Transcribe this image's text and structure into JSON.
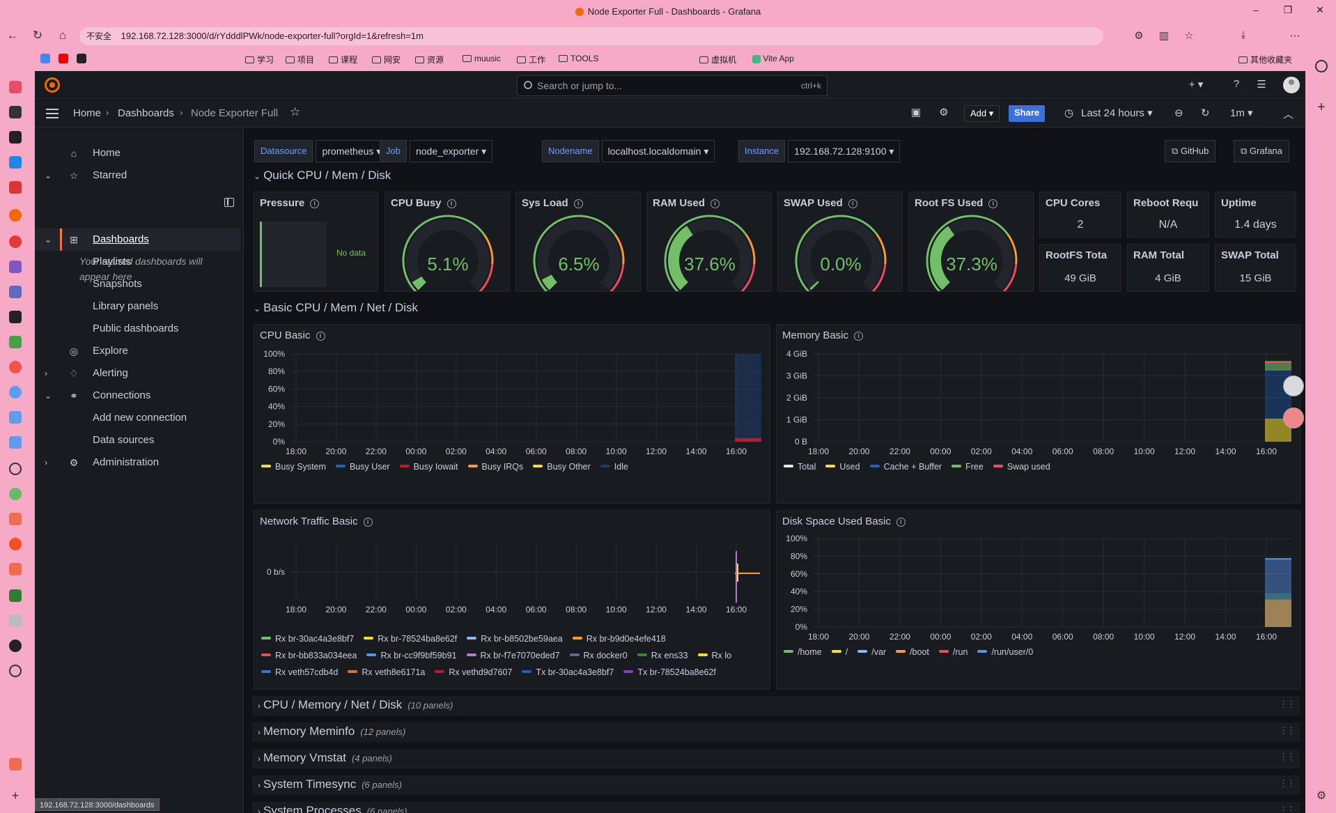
{
  "browser": {
    "window_title": "Node Exporter Full - Dashboards - Grafana",
    "security_label": "不安全",
    "url": "192.168.72.128:3000/d/rYdddlPWk/node-exporter-full?orgId=1&refresh=1m",
    "status_url": "192.168.72.128:3000/dashboards",
    "bookmarks": [
      "学习",
      "项目",
      "课程",
      "网安",
      "资源",
      "muusic",
      "工作",
      "TOOLS",
      "虚拟机",
      "Vite App"
    ],
    "other_bookmarks": "其他收藏夹"
  },
  "topnav": {
    "search_placeholder": "Search or jump to...",
    "search_shortcut": "ctrl+k"
  },
  "subnav": {
    "breadcrumbs": [
      "Home",
      "Dashboards",
      "Node Exporter Full"
    ],
    "add_label": "Add",
    "share_label": "Share",
    "time_range": "Last 24 hours",
    "refresh_interval": "1m"
  },
  "sidebar": {
    "items": [
      {
        "label": "Home",
        "icon": "home-icon"
      },
      {
        "label": "Starred",
        "icon": "star-icon"
      },
      {
        "label": "Dashboards",
        "icon": "apps-icon"
      },
      {
        "label": "Playlists"
      },
      {
        "label": "Snapshots"
      },
      {
        "label": "Library panels"
      },
      {
        "label": "Public dashboards"
      },
      {
        "label": "Explore",
        "icon": "compass-icon"
      },
      {
        "label": "Alerting",
        "icon": "bell-icon"
      },
      {
        "label": "Connections",
        "icon": "connections-icon"
      },
      {
        "label": "Add new connection"
      },
      {
        "label": "Data sources"
      },
      {
        "label": "Administration",
        "icon": "cog-icon"
      }
    ],
    "starred_note": "Your starred dashboards will appear here"
  },
  "variables": [
    {
      "label": "Datasource",
      "value": "prometheus"
    },
    {
      "label": "Job",
      "value": "node_exporter"
    },
    {
      "label": "Nodename",
      "value": "localhost.localdomain"
    },
    {
      "label": "Instance",
      "value": "192.168.72.128:9100"
    }
  ],
  "links": {
    "github": "GitHub",
    "grafana": "Grafana"
  },
  "rows": {
    "quick": "Quick CPU / Mem / Disk",
    "basic": "Basic CPU / Mem / Net / Disk",
    "collapsed": [
      {
        "title": "CPU / Memory / Net / Disk",
        "count": "(10 panels)"
      },
      {
        "title": "Memory Meminfo",
        "count": "(12 panels)"
      },
      {
        "title": "Memory Vmstat",
        "count": "(4 panels)"
      },
      {
        "title": "System Timesync",
        "count": "(6 panels)"
      },
      {
        "title": "System Processes",
        "count": "(6 panels)"
      }
    ]
  },
  "pressure": {
    "title": "Pressure",
    "value": "No data"
  },
  "gauges": [
    {
      "title": "CPU Busy",
      "value": "5.1%",
      "percent": 5.1
    },
    {
      "title": "Sys Load",
      "value": "6.5%",
      "percent": 6.5
    },
    {
      "title": "RAM Used",
      "value": "37.6%",
      "percent": 37.6
    },
    {
      "title": "SWAP Used",
      "value": "0.0%",
      "percent": 0
    },
    {
      "title": "Root FS Used",
      "value": "37.3%",
      "percent": 37.3
    }
  ],
  "stats": [
    {
      "title": "CPU Cores",
      "value": "2"
    },
    {
      "title": "Reboot Requ",
      "value": "N/A"
    },
    {
      "title": "Uptime",
      "value": "1.4 days"
    },
    {
      "title": "RootFS Tota",
      "value": "49 GiB"
    },
    {
      "title": "RAM Total",
      "value": "4 GiB"
    },
    {
      "title": "SWAP Total",
      "value": "15 GiB"
    }
  ],
  "colors": {
    "green": "#73bf69",
    "yellow": "#fade2a",
    "red": "#f2495c",
    "orange": "#ff9830",
    "blue": "#5794f2",
    "purple": "#b877d9",
    "darkred": "#c4162a",
    "darkblue": "#1f60c4"
  },
  "chart_data": [
    {
      "type": "area",
      "title": "CPU Basic",
      "x": [
        "18:00",
        "20:00",
        "22:00",
        "00:00",
        "02:00",
        "04:00",
        "06:00",
        "08:00",
        "10:00",
        "12:00",
        "14:00",
        "16:00"
      ],
      "yticks": [
        "100%",
        "80%",
        "60%",
        "40%",
        "20%",
        "0%"
      ],
      "ylim": [
        0,
        100
      ],
      "series": [
        {
          "name": "Busy System",
          "color": "#fade2a"
        },
        {
          "name": "Busy User",
          "color": "#1f60c4"
        },
        {
          "name": "Busy Iowait",
          "color": "#c4162a"
        },
        {
          "name": "Busy IRQs",
          "color": "#ff9830"
        },
        {
          "name": "Busy Other",
          "color": "#fade2a"
        },
        {
          "name": "Idle",
          "color": "#1f3a66"
        }
      ]
    },
    {
      "type": "area",
      "title": "Memory Basic",
      "x": [
        "18:00",
        "20:00",
        "22:00",
        "00:00",
        "02:00",
        "04:00",
        "06:00",
        "08:00",
        "10:00",
        "12:00",
        "14:00",
        "16:00"
      ],
      "yticks": [
        "4 GiB",
        "3 GiB",
        "2 GiB",
        "1 GiB",
        "0 B"
      ],
      "ylim": [
        0,
        4
      ],
      "series": [
        {
          "name": "Total",
          "color": "#e8e8e8"
        },
        {
          "name": "Used",
          "color": "#fade2a"
        },
        {
          "name": "Cache + Buffer",
          "color": "#1f60c4"
        },
        {
          "name": "Free",
          "color": "#73bf69"
        },
        {
          "name": "Swap used",
          "color": "#f2495c"
        }
      ]
    },
    {
      "type": "line",
      "title": "Network Traffic Basic",
      "x": [
        "18:00",
        "20:00",
        "22:00",
        "00:00",
        "02:00",
        "04:00",
        "06:00",
        "08:00",
        "10:00",
        "12:00",
        "14:00",
        "16:00"
      ],
      "yticks": [
        "0 b/s"
      ],
      "series": [
        {
          "name": "Rx br-30ac4a3e8bf7",
          "color": "#73bf69"
        },
        {
          "name": "Rx br-78524ba8e62f",
          "color": "#fade2a"
        },
        {
          "name": "Rx br-b8502be59aea",
          "color": "#8ab8ff"
        },
        {
          "name": "Rx br-b9d0e4efe418",
          "color": "#ff9830"
        },
        {
          "name": "Rx br-bb833a034eea",
          "color": "#f2495c"
        },
        {
          "name": "Rx br-cc9f9bf59b91",
          "color": "#5794f2"
        },
        {
          "name": "Rx br-f7e7070eded7",
          "color": "#b877d9"
        },
        {
          "name": "Rx docker0",
          "color": "#705da0"
        },
        {
          "name": "Rx ens33",
          "color": "#37872d"
        },
        {
          "name": "Rx lo",
          "color": "#fade2a"
        },
        {
          "name": "Rx veth57cdb4d",
          "color": "#3274d9"
        },
        {
          "name": "Rx veth8e6171a",
          "color": "#e0752d"
        },
        {
          "name": "Rx vethd9d7607",
          "color": "#c4162a"
        },
        {
          "name": "Tx br-30ac4a3e8bf7",
          "color": "#1f60c4"
        },
        {
          "name": "Tx br-78524ba8e62f",
          "color": "#8f3bb8"
        }
      ]
    },
    {
      "type": "area",
      "title": "Disk Space Used Basic",
      "x": [
        "18:00",
        "20:00",
        "22:00",
        "00:00",
        "02:00",
        "04:00",
        "06:00",
        "08:00",
        "10:00",
        "12:00",
        "14:00",
        "16:00"
      ],
      "yticks": [
        "100%",
        "80%",
        "60%",
        "40%",
        "20%",
        "0%"
      ],
      "ylim": [
        0,
        100
      ],
      "series": [
        {
          "name": "/home",
          "color": "#73bf69"
        },
        {
          "name": "/",
          "color": "#fade2a"
        },
        {
          "name": "/var",
          "color": "#8ab8ff"
        },
        {
          "name": "/boot",
          "color": "#ff9830"
        },
        {
          "name": "/run",
          "color": "#f2495c"
        },
        {
          "name": "/run/user/0",
          "color": "#5794f2"
        }
      ]
    }
  ]
}
